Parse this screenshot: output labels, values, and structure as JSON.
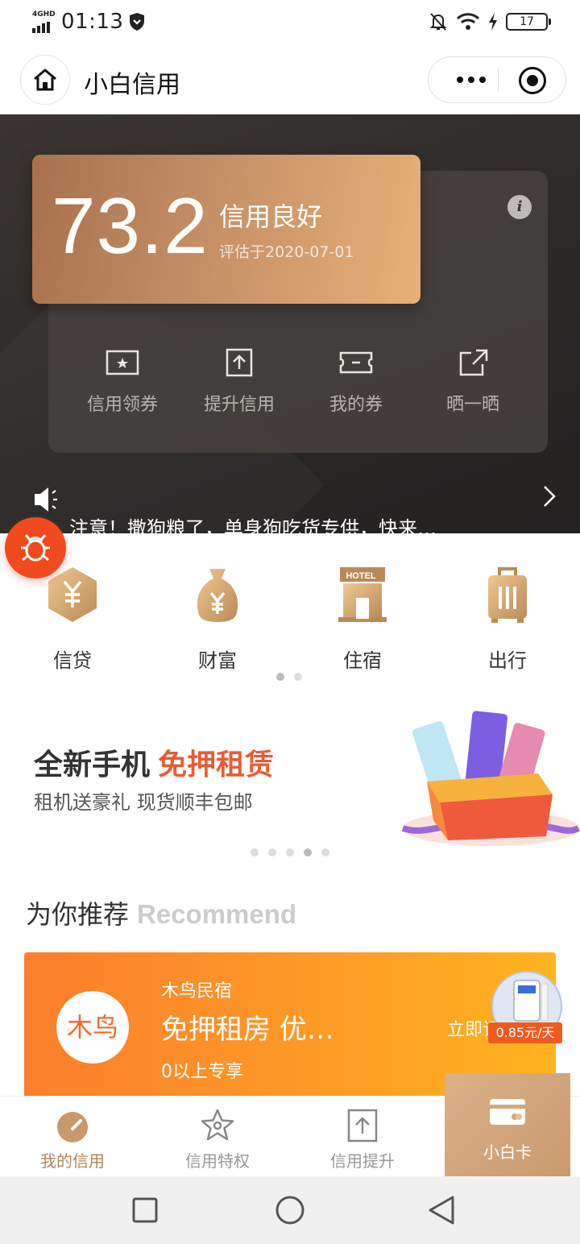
{
  "status_bar": {
    "network": "4GHD",
    "time": "01:13",
    "battery": "17"
  },
  "title_bar": {
    "title": "小白信用"
  },
  "credit": {
    "score": "73.2",
    "level": "信用良好",
    "evaluated": "评估于2020-07-01"
  },
  "quick_actions": [
    {
      "label": "信用领券",
      "icon": "coupon-star-icon"
    },
    {
      "label": "提升信用",
      "icon": "upload-arrow-icon"
    },
    {
      "label": "我的券",
      "icon": "ticket-icon"
    },
    {
      "label": "晒一晒",
      "icon": "share-external-icon"
    }
  ],
  "notice": {
    "text": "注意！撒狗粮了，单身狗吃货专供，快来…"
  },
  "categories": [
    {
      "label": "信贷",
      "icon": "loan-yen-icon"
    },
    {
      "label": "财富",
      "icon": "money-bag-icon"
    },
    {
      "label": "住宿",
      "icon": "hotel-icon",
      "badge": "HOTEL"
    },
    {
      "label": "出行",
      "icon": "luggage-icon"
    }
  ],
  "category_pager": {
    "pages": 2,
    "current": 1
  },
  "banner": {
    "title": "全新手机",
    "title_highlight": "免押租赁",
    "subtitle": "租机送豪礼  现货顺丰包邮"
  },
  "banner_pager": {
    "pages": 5,
    "current": 4
  },
  "recommend": {
    "title": "为你推荐",
    "title_en": "Recommend",
    "card": {
      "logo_text": "木鸟",
      "brand": "木鸟民宿",
      "headline": "免押租房 优…",
      "condition": "0以上专享",
      "cta": "立即订"
    },
    "float_ad_price": "0.85元/天"
  },
  "tabbar": [
    {
      "label": "我的信用",
      "icon": "gauge-icon",
      "active": true
    },
    {
      "label": "信用特权",
      "icon": "star-outline-icon",
      "active": false
    },
    {
      "label": "信用提升",
      "icon": "upload-box-icon",
      "active": false
    },
    {
      "label": "小白卡",
      "icon": "card-icon",
      "active": false
    }
  ],
  "colors": {
    "accent_gold": "#b3875d",
    "hero_bg": "#2a2827",
    "highlight_orange": "#e85c34",
    "rec_card_start": "#fb7e2c",
    "rec_card_end": "#ffb31f"
  }
}
